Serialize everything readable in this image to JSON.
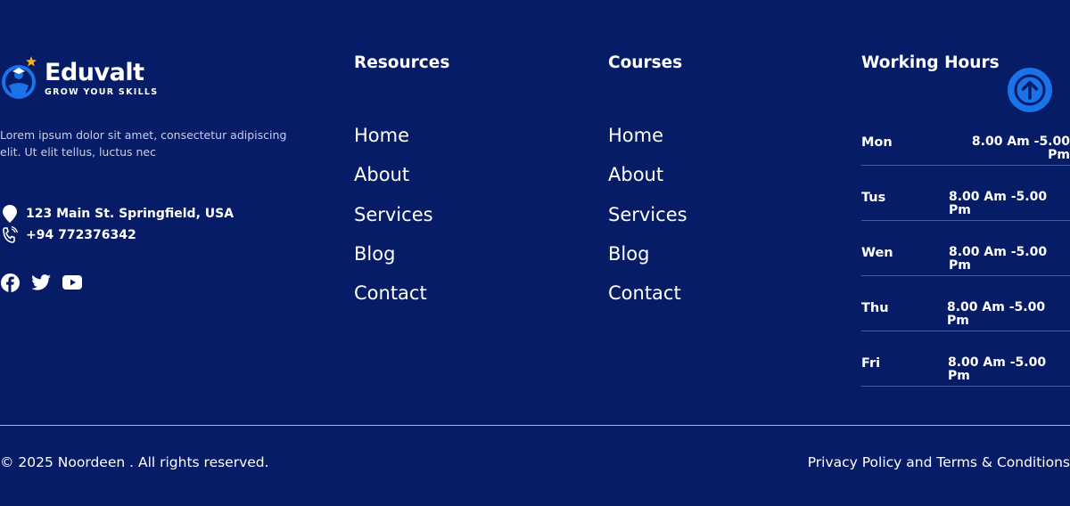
{
  "brand": {
    "name": "Eduvalt",
    "tagline": "GROW YOUR SKILLS",
    "description": "Lorem ipsum dolor sit amet, consectetur adipiscing elit. Ut elit tellus, luctus nec",
    "address": "123 Main St. Springfield, USA",
    "phone": "+94 772376342",
    "socials": [
      "facebook-icon",
      "twitter-icon",
      "youtube-icon"
    ]
  },
  "resources": {
    "title": "Resources",
    "links": [
      "Home",
      "About",
      "Services",
      "Blog",
      "Contact"
    ]
  },
  "courses": {
    "title": "Courses",
    "links": [
      "Home",
      "About",
      "Services",
      "Blog",
      "Contact"
    ]
  },
  "hours": {
    "title": "Working Hours",
    "rows": [
      {
        "day": "Mon",
        "time": "8.00 Am -5.00 Pm"
      },
      {
        "day": "Tus",
        "time": "8.00 Am -5.00 Pm"
      },
      {
        "day": "Wen",
        "time": "8.00 Am -5.00 Pm"
      },
      {
        "day": "Thu",
        "time": "8.00 Am -5.00 Pm"
      },
      {
        "day": "Fri",
        "time": "8.00 Am -5.00 Pm"
      }
    ]
  },
  "bottom": {
    "copyright": "© 2025 Noordeen . All rights reserved.",
    "legal": "Privacy Policy and Terms & Conditions"
  },
  "colors": {
    "background": "#061c66",
    "accent": "#1a73e8",
    "star": "#f5b21a"
  }
}
